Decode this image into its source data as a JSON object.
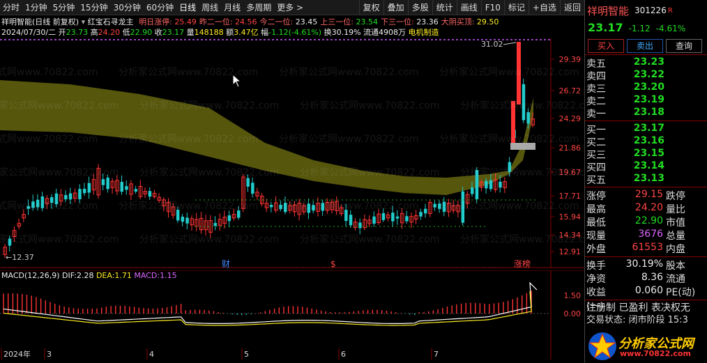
{
  "toolbar": {
    "left": [
      "分时",
      "1分钟",
      "5分钟",
      "15分钟",
      "30分钟",
      "60分钟",
      "日线",
      "周线",
      "月线",
      "多周期",
      "更多 >"
    ],
    "active": "日线",
    "right": [
      "复权",
      "叠加",
      "多股",
      "统计",
      "画线",
      "F10",
      "标记",
      "+自选",
      "返回"
    ]
  },
  "title_line": {
    "name": "祥明智能(日线 前复权)",
    "indicator": "红宝石寻龙主",
    "items": [
      {
        "label": "明日涨停:",
        "value": "25.49",
        "color": "#ff4444"
      },
      {
        "label": "昨二一位:",
        "value": "24.56",
        "color": "#ff4444"
      },
      {
        "label": "今二一位:",
        "value": "23.45",
        "color": "#eeeeee"
      },
      {
        "label": "上三一位:",
        "value": "23.54",
        "color": "#22dd22"
      },
      {
        "label": "下三一位:",
        "value": "23.36",
        "color": "#eeeeee"
      },
      {
        "label": "大阴买顶:",
        "value": "29.50",
        "color": "#ffee22"
      }
    ]
  },
  "info_line": {
    "date": "2024/07/30/二",
    "open_label": "开",
    "open": "23.73",
    "high_label": "高",
    "high": "24.20",
    "low_label": "低",
    "low": "22.90",
    "close_label": "收",
    "close": "23.17",
    "vol_label": "量",
    "vol": "148188",
    "amt_label": "额",
    "amt": "3.47亿",
    "chg_label": "幅",
    "chg": "-1.12(-4.61%)",
    "turn_label": "换",
    "turn": "30.19%",
    "float_label": "流通",
    "float": "4908万",
    "sector": "电机制造"
  },
  "price_axis": [
    "29.39",
    "26.72",
    "24.29",
    "21.86",
    "19.67",
    "17.71",
    "15.94",
    "14.34",
    "12.91"
  ],
  "chart_annotations": {
    "high_mark": "31.02",
    "low_mark": "12.37",
    "tags": [
      "财",
      "$",
      "涨榜"
    ]
  },
  "macd": {
    "name": "MACD(12,26,9)",
    "dif_label": "DIF:",
    "dif": "2.28",
    "dea_label": "DEA:",
    "dea": "1.71",
    "macd_label": "MACD:",
    "macd": "1.15",
    "axis": [
      "1.50",
      "0.00"
    ]
  },
  "time_axis": [
    "2024年",
    "3",
    "4",
    "5",
    "6",
    "7"
  ],
  "watermark": "分析家公式网www.70822.com",
  "colors": {
    "up": "#ff3333",
    "down": "#22cccc",
    "band": "#6b6b10",
    "dif": "#ffffff",
    "dea": "#ffee22"
  },
  "right_panel": {
    "name": "祥明智能",
    "code": "301226",
    "tag": "R",
    "price": "23.17",
    "change": "-1.12",
    "pct": "-4.61%",
    "buttons": {
      "buy": "买入",
      "sell": "卖出",
      "cancel": "查询"
    },
    "sells": [
      {
        "label": "卖五",
        "price": "23.23"
      },
      {
        "label": "卖四",
        "price": "23.22"
      },
      {
        "label": "卖三",
        "price": "23.20"
      },
      {
        "label": "卖二",
        "price": "23.19"
      },
      {
        "label": "卖一",
        "price": "23.18"
      }
    ],
    "buys": [
      {
        "label": "买一",
        "price": "23.17"
      },
      {
        "label": "买二",
        "price": "23.16"
      },
      {
        "label": "买三",
        "price": "23.15"
      },
      {
        "label": "买四",
        "price": "23.14"
      },
      {
        "label": "买五",
        "price": "23.13"
      }
    ],
    "stats": [
      {
        "l": "涨停",
        "v": "29.15",
        "vc": "#ff4444",
        "r": "跌停"
      },
      {
        "l": "最高",
        "v": "24.20",
        "vc": "#ff4444",
        "r": "量比"
      },
      {
        "l": "最低",
        "v": "22.90",
        "vc": "#22dd22",
        "r": "市值"
      },
      {
        "l": "现量",
        "v": "3676",
        "vc": "#dd66ff",
        "r": "总量"
      },
      {
        "l": "外盘",
        "v": "61553",
        "vc": "#ff4444",
        "r": "内盘"
      }
    ],
    "stats2": [
      {
        "l": "换手",
        "v": "30.19%",
        "r": "股本"
      },
      {
        "l": "净资",
        "v": "8.36",
        "r": "流通"
      },
      {
        "l": "收益(一)",
        "v": "0.060",
        "r": "PE(动)"
      }
    ],
    "reg": "注册制 已盈利 表决权无",
    "trade": "交易状态: 闭市阶段 15:3",
    "logo_text": "分析家公式网",
    "logo_url": "www.70822.com"
  }
}
